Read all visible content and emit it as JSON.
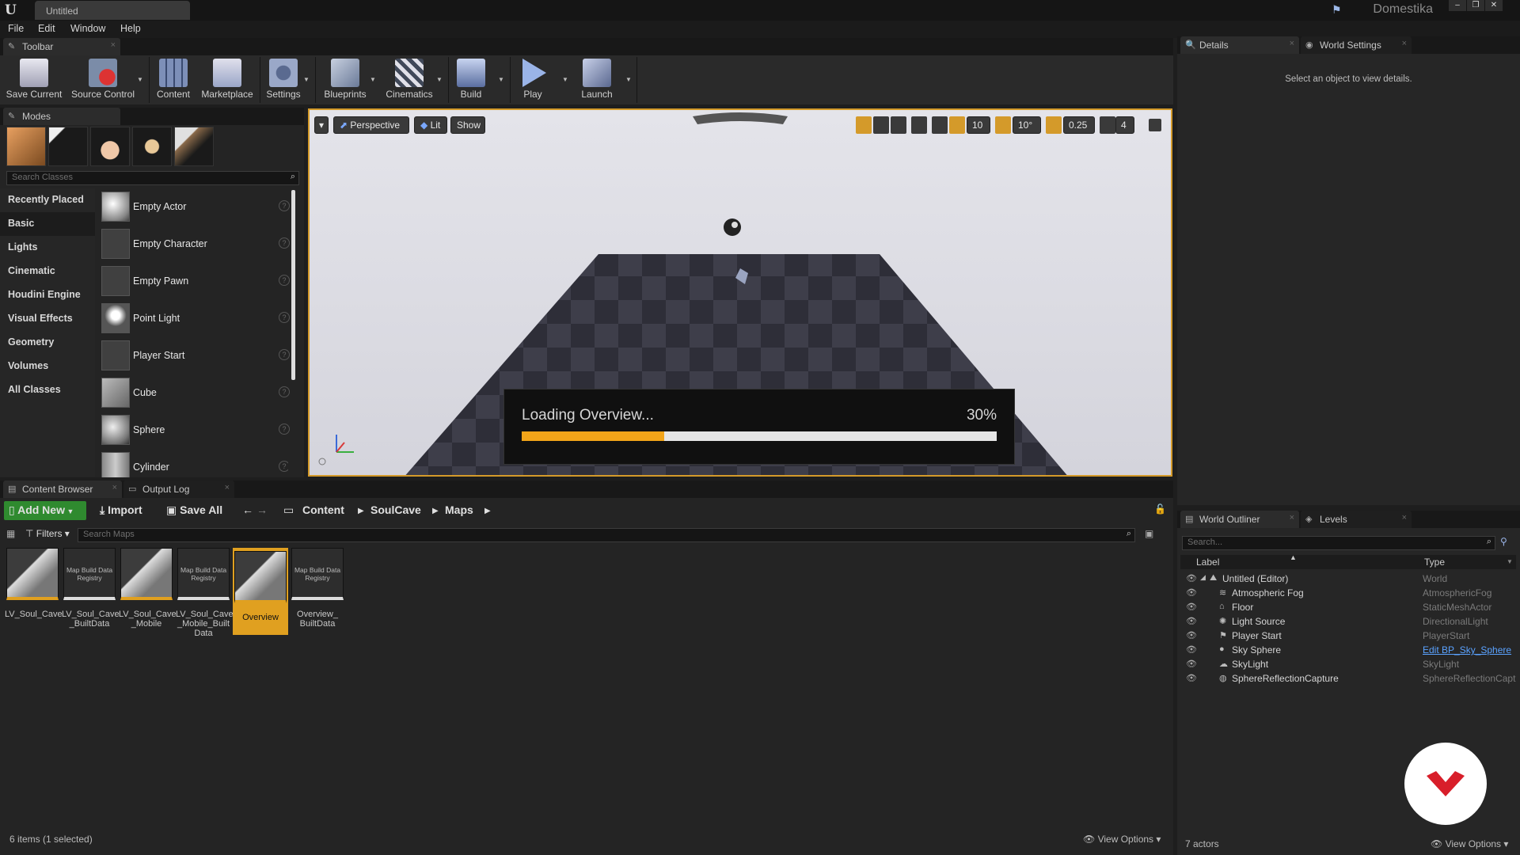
{
  "titlebar": {
    "tab": "Untitled",
    "brand": "Domestika",
    "win_buttons": [
      "–",
      "❐",
      "✕"
    ]
  },
  "menu": [
    "File",
    "Edit",
    "Window",
    "Help"
  ],
  "toolbar_panel": {
    "tab": "Toolbar",
    "buttons": [
      {
        "label": "Save Current",
        "icon": "save-icon"
      },
      {
        "label": "Source Control",
        "icon": "source-control-icon"
      },
      {
        "label": "Content",
        "icon": "content-icon"
      },
      {
        "label": "Marketplace",
        "icon": "marketplace-icon"
      },
      {
        "label": "Settings",
        "icon": "settings-icon"
      },
      {
        "label": "Blueprints",
        "icon": "blueprints-icon"
      },
      {
        "label": "Cinematics",
        "icon": "cinematics-icon"
      },
      {
        "label": "Build",
        "icon": "build-icon"
      },
      {
        "label": "Play",
        "icon": "play-icon"
      },
      {
        "label": "Launch",
        "icon": "launch-icon"
      }
    ]
  },
  "modes": {
    "tab": "Modes",
    "search_placeholder": "Search Classes",
    "categories": [
      "Recently Placed",
      "Basic",
      "Lights",
      "Cinematic",
      "Houdini Engine",
      "Visual Effects",
      "Geometry",
      "Volumes",
      "All Classes"
    ],
    "selected_category": "Basic",
    "items": [
      "Empty Actor",
      "Empty Character",
      "Empty Pawn",
      "Point Light",
      "Player Start",
      "Cube",
      "Sphere",
      "Cylinder"
    ]
  },
  "viewport": {
    "view_mode": "Perspective",
    "lit": "Lit",
    "show": "Show",
    "grid_snap": "10",
    "rot_snap": "10°",
    "scale_snap": "0.25",
    "cam_speed": "4",
    "loading": {
      "text": "Loading Overview...",
      "percent_label": "30%",
      "progress": 0.3
    }
  },
  "details": {
    "tab1": "Details",
    "tab2": "World Settings",
    "empty_text": "Select an object to view details."
  },
  "content_browser": {
    "tab1": "Content Browser",
    "tab2": "Output Log",
    "add_new": "Add New",
    "import": "Import",
    "save_all": "Save All",
    "path": [
      "Content",
      "SoulCave",
      "Maps"
    ],
    "filters": "Filters",
    "search_placeholder": "Search Maps",
    "assets": [
      {
        "label": "LV_Soul_Cave",
        "kind": "map",
        "selected": false
      },
      {
        "label": "LV_Soul_Cave _BuiltData",
        "kind": "data",
        "selected": false
      },
      {
        "label": "LV_Soul_Cave _Mobile",
        "kind": "map",
        "selected": false
      },
      {
        "label": "LV_Soul_Cave _Mobile_Built Data",
        "kind": "data",
        "selected": false
      },
      {
        "label": "Overview",
        "kind": "map",
        "selected": true
      },
      {
        "label": "Overview_ BuiltData",
        "kind": "data",
        "selected": false
      }
    ],
    "data_thumb_text": "Map Build Data Registry",
    "status": "6 items (1 selected)",
    "view_options": "View Options"
  },
  "outliner": {
    "tab1": "World Outliner",
    "tab2": "Levels",
    "search_placeholder": "Search...",
    "col_label": "Label",
    "col_type": "Type",
    "rows": [
      {
        "name": "Untitled (Editor)",
        "type": "World",
        "link": false,
        "indent": 0
      },
      {
        "name": "Atmospheric Fog",
        "type": "AtmosphericFog",
        "link": false,
        "indent": 1
      },
      {
        "name": "Floor",
        "type": "StaticMeshActor",
        "link": false,
        "indent": 1
      },
      {
        "name": "Light Source",
        "type": "DirectionalLight",
        "link": false,
        "indent": 1
      },
      {
        "name": "Player Start",
        "type": "PlayerStart",
        "link": false,
        "indent": 1
      },
      {
        "name": "Sky Sphere",
        "type": "Edit BP_Sky_Sphere",
        "link": true,
        "indent": 1
      },
      {
        "name": "SkyLight",
        "type": "SkyLight",
        "link": false,
        "indent": 1
      },
      {
        "name": "SphereReflectionCapture",
        "type": "SphereReflectionCapt",
        "link": false,
        "indent": 1
      }
    ],
    "status": "7 actors",
    "view_options": "View Options"
  },
  "colors": {
    "accent": "#f2a419",
    "selection": "#e0a020",
    "link": "#5aa2ff"
  }
}
